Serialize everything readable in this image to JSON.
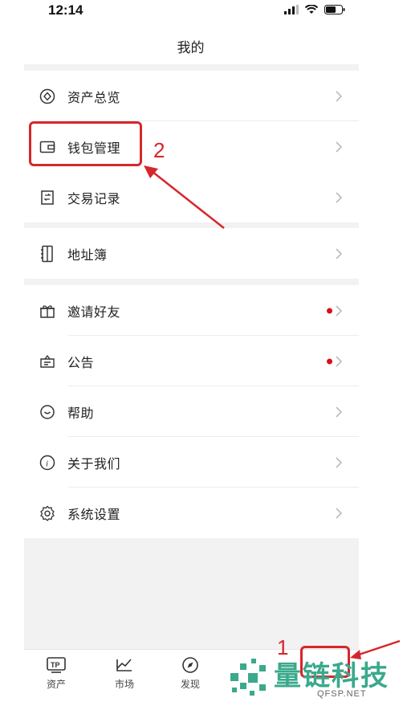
{
  "status_bar": {
    "time": "12:14"
  },
  "header": {
    "title": "我的"
  },
  "groups": [
    {
      "items": [
        {
          "label": "资产总览",
          "icon": "asset-overview-icon",
          "dot": false
        },
        {
          "label": "钱包管理",
          "icon": "wallet-icon",
          "dot": false
        },
        {
          "label": "交易记录",
          "icon": "transaction-record-icon",
          "dot": false
        }
      ]
    },
    {
      "items": [
        {
          "label": "地址簿",
          "icon": "address-book-icon",
          "dot": false
        }
      ]
    },
    {
      "items": [
        {
          "label": "邀请好友",
          "icon": "gift-icon",
          "dot": true
        },
        {
          "label": "公告",
          "icon": "announcement-icon",
          "dot": true
        },
        {
          "label": "帮助",
          "icon": "help-icon",
          "dot": false
        },
        {
          "label": "关于我们",
          "icon": "info-icon",
          "dot": false
        },
        {
          "label": "系统设置",
          "icon": "settings-gear-icon",
          "dot": false
        }
      ]
    }
  ],
  "annotations": {
    "step1": "1",
    "step2": "2"
  },
  "tabbar": {
    "tabs": [
      {
        "label": "资产",
        "icon": "tp-assets-icon"
      },
      {
        "label": "市场",
        "icon": "market-chart-icon"
      },
      {
        "label": "发现",
        "icon": "compass-icon"
      }
    ]
  },
  "watermark": {
    "text": "量链科技",
    "sub": "QFSP.NET"
  },
  "colors": {
    "annotation": "#d7262b",
    "dot": "#d4101d",
    "background": "#f2f2f2",
    "watermark": "#3aa98c"
  }
}
